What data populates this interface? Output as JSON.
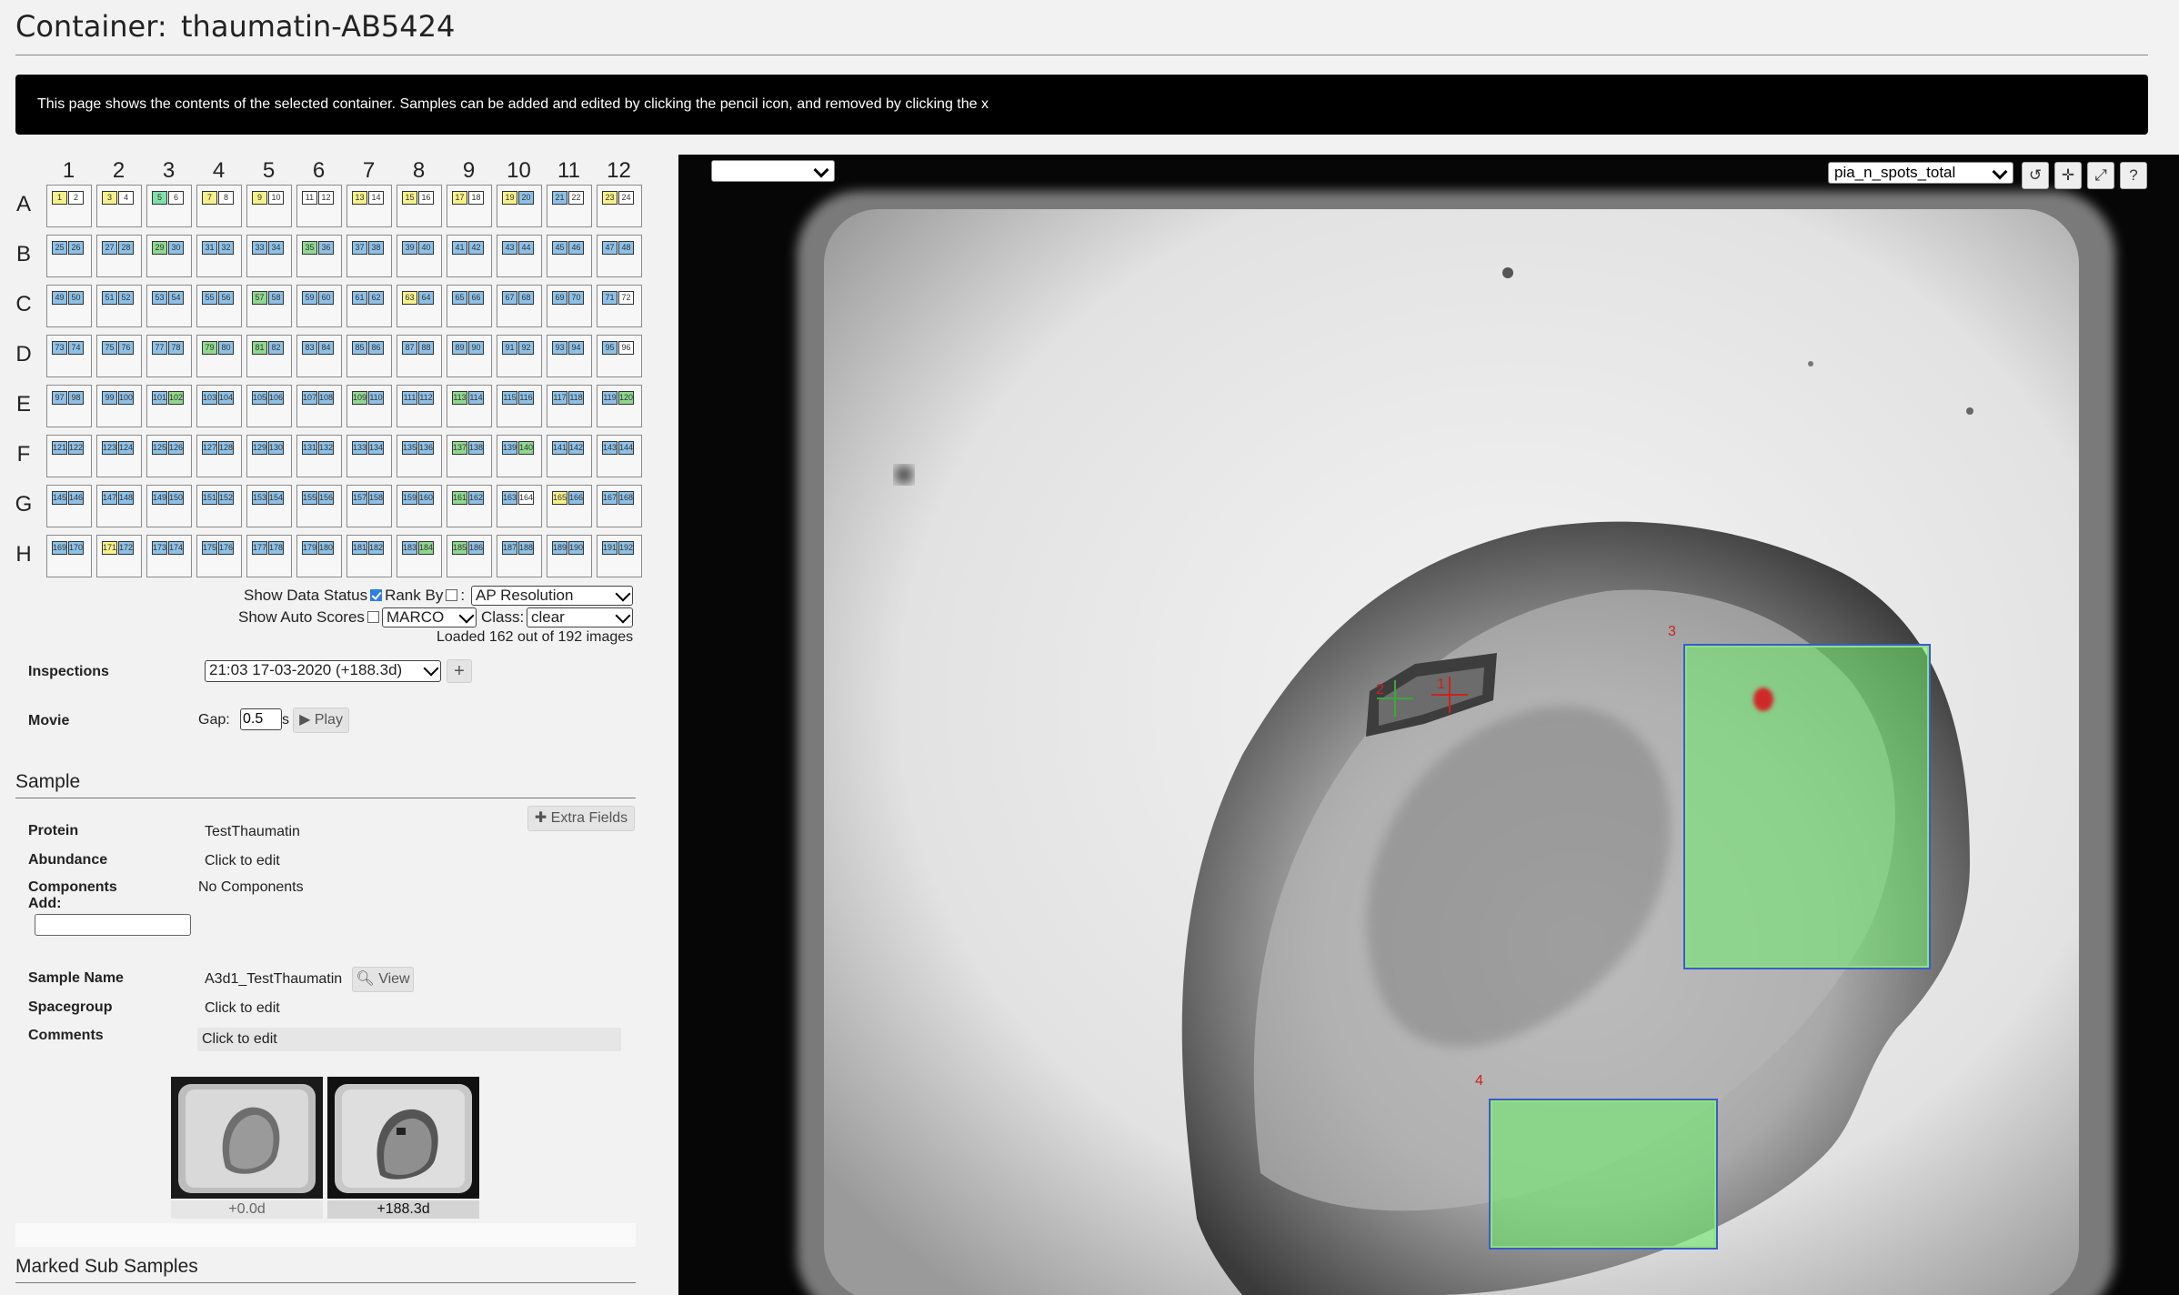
{
  "header": {
    "label": "Container:",
    "name": "thaumatin-AB5424"
  },
  "notice": "This page shows the contents of the selected container. Samples can be added and edited by clicking the pencil icon, and removed by clicking the x",
  "plate": {
    "columns": [
      "1",
      "2",
      "3",
      "4",
      "5",
      "6",
      "7",
      "8",
      "9",
      "10",
      "11",
      "12"
    ],
    "rows": [
      "A",
      "B",
      "C",
      "D",
      "E",
      "F",
      "G",
      "H"
    ],
    "wells": [
      [
        [
          "1",
          "y"
        ],
        [
          "2",
          "w"
        ],
        [
          "3",
          "y"
        ],
        [
          "4",
          "w"
        ],
        [
          "5",
          "gb"
        ],
        [
          "6",
          "w"
        ],
        [
          "7",
          "y"
        ],
        [
          "8",
          "w"
        ],
        [
          "9",
          "y"
        ],
        [
          "10",
          "w"
        ],
        [
          "11",
          "w"
        ],
        [
          "12",
          "w"
        ],
        [
          "13",
          "y"
        ],
        [
          "14",
          "w"
        ],
        [
          "15",
          "y"
        ],
        [
          "16",
          "w"
        ],
        [
          "17",
          "y"
        ],
        [
          "18",
          "w"
        ],
        [
          "19",
          "y"
        ],
        [
          "20",
          "b"
        ],
        [
          "21",
          "b"
        ],
        [
          "22",
          "w"
        ],
        [
          "23",
          "y"
        ],
        [
          "24",
          "w"
        ]
      ],
      [
        [
          "25",
          "b"
        ],
        [
          "26",
          "b"
        ],
        [
          "27",
          "b"
        ],
        [
          "28",
          "b"
        ],
        [
          "29",
          "g"
        ],
        [
          "30",
          "b"
        ],
        [
          "31",
          "b"
        ],
        [
          "32",
          "b"
        ],
        [
          "33",
          "b"
        ],
        [
          "34",
          "b"
        ],
        [
          "35",
          "g"
        ],
        [
          "36",
          "b"
        ],
        [
          "37",
          "b"
        ],
        [
          "38",
          "b"
        ],
        [
          "39",
          "b"
        ],
        [
          "40",
          "b"
        ],
        [
          "41",
          "b"
        ],
        [
          "42",
          "b"
        ],
        [
          "43",
          "b"
        ],
        [
          "44",
          "b"
        ],
        [
          "45",
          "b"
        ],
        [
          "46",
          "b"
        ],
        [
          "47",
          "b"
        ],
        [
          "48",
          "b"
        ]
      ],
      [
        [
          "49",
          "b"
        ],
        [
          "50",
          "b"
        ],
        [
          "51",
          "b"
        ],
        [
          "52",
          "b"
        ],
        [
          "53",
          "b"
        ],
        [
          "54",
          "b"
        ],
        [
          "55",
          "b"
        ],
        [
          "56",
          "b"
        ],
        [
          "57",
          "g"
        ],
        [
          "58",
          "b"
        ],
        [
          "59",
          "b"
        ],
        [
          "60",
          "b"
        ],
        [
          "61",
          "b"
        ],
        [
          "62",
          "b"
        ],
        [
          "63",
          "y"
        ],
        [
          "64",
          "b"
        ],
        [
          "65",
          "b"
        ],
        [
          "66",
          "b"
        ],
        [
          "67",
          "b"
        ],
        [
          "68",
          "b"
        ],
        [
          "69",
          "b"
        ],
        [
          "70",
          "b"
        ],
        [
          "71",
          "b"
        ],
        [
          "72",
          "w"
        ]
      ],
      [
        [
          "73",
          "b"
        ],
        [
          "74",
          "b"
        ],
        [
          "75",
          "b"
        ],
        [
          "76",
          "b"
        ],
        [
          "77",
          "b"
        ],
        [
          "78",
          "b"
        ],
        [
          "79",
          "g"
        ],
        [
          "80",
          "b"
        ],
        [
          "81",
          "g"
        ],
        [
          "82",
          "b"
        ],
        [
          "83",
          "b"
        ],
        [
          "84",
          "b"
        ],
        [
          "85",
          "b"
        ],
        [
          "86",
          "b"
        ],
        [
          "87",
          "b"
        ],
        [
          "88",
          "b"
        ],
        [
          "89",
          "b"
        ],
        [
          "90",
          "b"
        ],
        [
          "91",
          "b"
        ],
        [
          "92",
          "b"
        ],
        [
          "93",
          "b"
        ],
        [
          "94",
          "b"
        ],
        [
          "95",
          "b"
        ],
        [
          "96",
          "w"
        ]
      ],
      [
        [
          "97",
          "b"
        ],
        [
          "98",
          "b"
        ],
        [
          "99",
          "b"
        ],
        [
          "100",
          "b"
        ],
        [
          "101",
          "b"
        ],
        [
          "102",
          "g"
        ],
        [
          "103",
          "b"
        ],
        [
          "104",
          "b"
        ],
        [
          "105",
          "b"
        ],
        [
          "106",
          "b"
        ],
        [
          "107",
          "b"
        ],
        [
          "108",
          "b"
        ],
        [
          "109",
          "g"
        ],
        [
          "110",
          "b"
        ],
        [
          "111",
          "b"
        ],
        [
          "112",
          "b"
        ],
        [
          "113",
          "g"
        ],
        [
          "114",
          "b"
        ],
        [
          "115",
          "b"
        ],
        [
          "116",
          "b"
        ],
        [
          "117",
          "b"
        ],
        [
          "118",
          "b"
        ],
        [
          "119",
          "b"
        ],
        [
          "120",
          "g"
        ]
      ],
      [
        [
          "121",
          "b"
        ],
        [
          "122",
          "b"
        ],
        [
          "123",
          "b"
        ],
        [
          "124",
          "b"
        ],
        [
          "125",
          "b"
        ],
        [
          "126",
          "b"
        ],
        [
          "127",
          "b"
        ],
        [
          "128",
          "b"
        ],
        [
          "129",
          "b"
        ],
        [
          "130",
          "b"
        ],
        [
          "131",
          "b"
        ],
        [
          "132",
          "b"
        ],
        [
          "133",
          "b"
        ],
        [
          "134",
          "b"
        ],
        [
          "135",
          "b"
        ],
        [
          "136",
          "b"
        ],
        [
          "137",
          "g"
        ],
        [
          "138",
          "b"
        ],
        [
          "139",
          "b"
        ],
        [
          "140",
          "g"
        ],
        [
          "141",
          "b"
        ],
        [
          "142",
          "b"
        ],
        [
          "143",
          "b"
        ],
        [
          "144",
          "b"
        ]
      ],
      [
        [
          "145",
          "b"
        ],
        [
          "146",
          "b"
        ],
        [
          "147",
          "b"
        ],
        [
          "148",
          "b"
        ],
        [
          "149",
          "b"
        ],
        [
          "150",
          "b"
        ],
        [
          "151",
          "b"
        ],
        [
          "152",
          "b"
        ],
        [
          "153",
          "b"
        ],
        [
          "154",
          "b"
        ],
        [
          "155",
          "b"
        ],
        [
          "156",
          "b"
        ],
        [
          "157",
          "b"
        ],
        [
          "158",
          "b"
        ],
        [
          "159",
          "b"
        ],
        [
          "160",
          "b"
        ],
        [
          "161",
          "g"
        ],
        [
          "162",
          "b"
        ],
        [
          "163",
          "b"
        ],
        [
          "164",
          "w"
        ],
        [
          "165",
          "y"
        ],
        [
          "166",
          "b"
        ],
        [
          "167",
          "b"
        ],
        [
          "168",
          "b"
        ]
      ],
      [
        [
          "169",
          "b"
        ],
        [
          "170",
          "b"
        ],
        [
          "171",
          "y"
        ],
        [
          "172",
          "b"
        ],
        [
          "173",
          "b"
        ],
        [
          "174",
          "b"
        ],
        [
          "175",
          "b"
        ],
        [
          "176",
          "b"
        ],
        [
          "177",
          "b"
        ],
        [
          "178",
          "b"
        ],
        [
          "179",
          "b"
        ],
        [
          "180",
          "b"
        ],
        [
          "181",
          "b"
        ],
        [
          "182",
          "b"
        ],
        [
          "183",
          "b"
        ],
        [
          "184",
          "g"
        ],
        [
          "185",
          "g"
        ],
        [
          "186",
          "b"
        ],
        [
          "187",
          "b"
        ],
        [
          "188",
          "b"
        ],
        [
          "189",
          "b"
        ],
        [
          "190",
          "b"
        ],
        [
          "191",
          "b"
        ],
        [
          "192",
          "b"
        ]
      ]
    ]
  },
  "controls": {
    "show_data_status": "Show Data Status",
    "rank_by": "Rank By",
    "rank_sep": ":",
    "rank_value": "AP Resolution",
    "show_auto_scores": "Show Auto Scores",
    "auto_value": "MARCO",
    "class_label": "Class:",
    "class_value": "clear",
    "loaded": "Loaded 162 out of 192 images"
  },
  "inspections": {
    "label": "Inspections",
    "value": "21:03 17-03-2020 (+188.3d)",
    "add": "+"
  },
  "movie": {
    "label": "Movie",
    "gap_label": "Gap:",
    "gap_value": "0.5",
    "unit": "s",
    "play": "▶ Play"
  },
  "sample": {
    "section": "Sample",
    "extra_fields": "✚ Extra Fields",
    "protein_label": "Protein",
    "protein": "TestThaumatin",
    "abundance_label": "Abundance",
    "abundance": "Click to edit",
    "components_label": "Components",
    "add_label": "Add:",
    "components": "No Components",
    "name_label": "Sample Name",
    "name": "A3d1_TestThaumatin",
    "view": "View",
    "spacegroup_label": "Spacegroup",
    "spacegroup": "Click to edit",
    "comments_label": "Comments",
    "comments": "Click to edit"
  },
  "thumbs": [
    {
      "caption": "+0.0d"
    },
    {
      "caption": "+188.3d"
    }
  ],
  "marked": {
    "section": "Marked Sub Samples"
  },
  "viewer": {
    "left_select": "",
    "score_select": "pia_n_spots_total",
    "tools": [
      "↺",
      "✛",
      "⤢",
      "?"
    ],
    "marks": [
      "1",
      "2",
      "3",
      "4"
    ]
  }
}
